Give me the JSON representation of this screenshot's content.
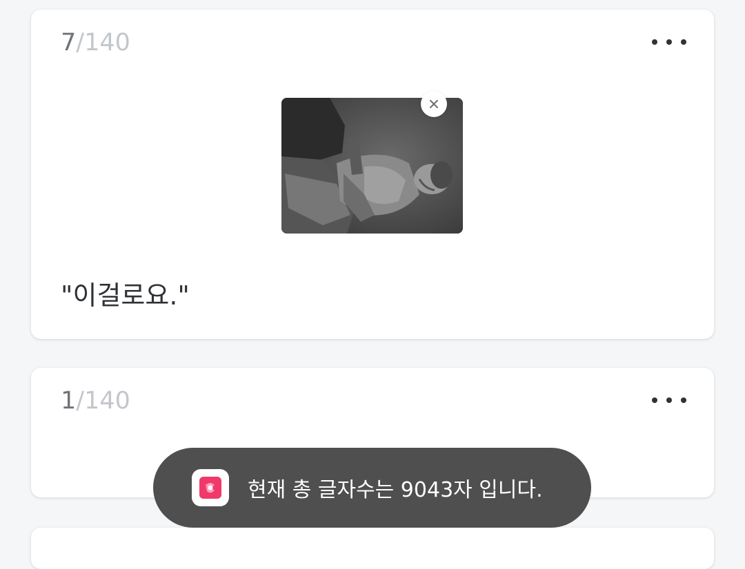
{
  "cards": [
    {
      "counter_current": "7",
      "counter_sep": "/",
      "counter_max": "140",
      "more_label": "more options",
      "image_icon": "statue-photo",
      "text": "\"이걸로요.\""
    },
    {
      "counter_current": "1",
      "counter_sep": "/",
      "counter_max": "140",
      "more_label": "more options",
      "text": ""
    }
  ],
  "toast": {
    "app_icon": "app-logo-icon",
    "message": "현재 총 글자수는 9043자 입니다."
  },
  "colors": {
    "background": "#f5f6f8",
    "card": "#ffffff",
    "toast_bg": "#4f4f4f",
    "app_icon_accent": "#f0386b"
  }
}
